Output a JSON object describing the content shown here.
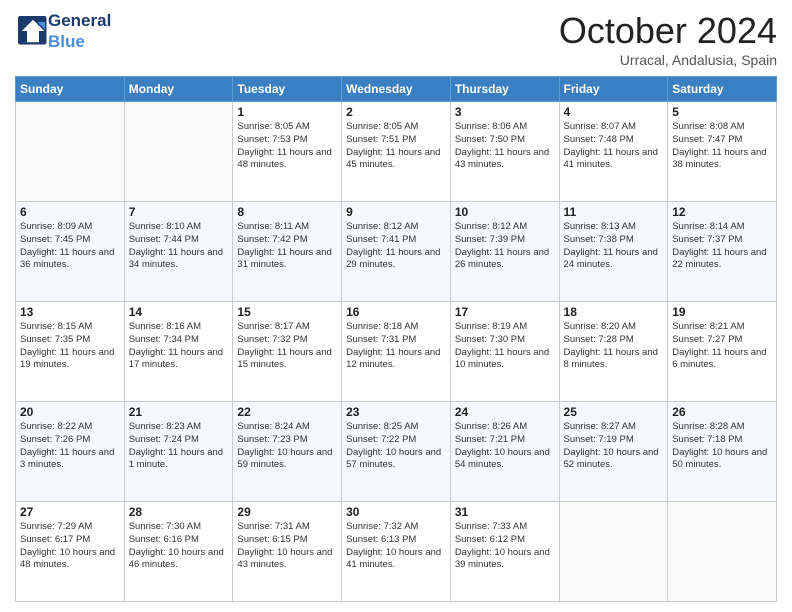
{
  "header": {
    "logo_general": "General",
    "logo_blue": "Blue",
    "month_title": "October 2024",
    "subtitle": "Urracal, Andalusia, Spain"
  },
  "weekdays": [
    "Sunday",
    "Monday",
    "Tuesday",
    "Wednesday",
    "Thursday",
    "Friday",
    "Saturday"
  ],
  "weeks": [
    [
      {
        "day": "",
        "info": ""
      },
      {
        "day": "",
        "info": ""
      },
      {
        "day": "1",
        "info": "Sunrise: 8:05 AM\nSunset: 7:53 PM\nDaylight: 11 hours and 48 minutes."
      },
      {
        "day": "2",
        "info": "Sunrise: 8:05 AM\nSunset: 7:51 PM\nDaylight: 11 hours and 45 minutes."
      },
      {
        "day": "3",
        "info": "Sunrise: 8:06 AM\nSunset: 7:50 PM\nDaylight: 11 hours and 43 minutes."
      },
      {
        "day": "4",
        "info": "Sunrise: 8:07 AM\nSunset: 7:48 PM\nDaylight: 11 hours and 41 minutes."
      },
      {
        "day": "5",
        "info": "Sunrise: 8:08 AM\nSunset: 7:47 PM\nDaylight: 11 hours and 38 minutes."
      }
    ],
    [
      {
        "day": "6",
        "info": "Sunrise: 8:09 AM\nSunset: 7:45 PM\nDaylight: 11 hours and 36 minutes."
      },
      {
        "day": "7",
        "info": "Sunrise: 8:10 AM\nSunset: 7:44 PM\nDaylight: 11 hours and 34 minutes."
      },
      {
        "day": "8",
        "info": "Sunrise: 8:11 AM\nSunset: 7:42 PM\nDaylight: 11 hours and 31 minutes."
      },
      {
        "day": "9",
        "info": "Sunrise: 8:12 AM\nSunset: 7:41 PM\nDaylight: 11 hours and 29 minutes."
      },
      {
        "day": "10",
        "info": "Sunrise: 8:12 AM\nSunset: 7:39 PM\nDaylight: 11 hours and 26 minutes."
      },
      {
        "day": "11",
        "info": "Sunrise: 8:13 AM\nSunset: 7:38 PM\nDaylight: 11 hours and 24 minutes."
      },
      {
        "day": "12",
        "info": "Sunrise: 8:14 AM\nSunset: 7:37 PM\nDaylight: 11 hours and 22 minutes."
      }
    ],
    [
      {
        "day": "13",
        "info": "Sunrise: 8:15 AM\nSunset: 7:35 PM\nDaylight: 11 hours and 19 minutes."
      },
      {
        "day": "14",
        "info": "Sunrise: 8:16 AM\nSunset: 7:34 PM\nDaylight: 11 hours and 17 minutes."
      },
      {
        "day": "15",
        "info": "Sunrise: 8:17 AM\nSunset: 7:32 PM\nDaylight: 11 hours and 15 minutes."
      },
      {
        "day": "16",
        "info": "Sunrise: 8:18 AM\nSunset: 7:31 PM\nDaylight: 11 hours and 12 minutes."
      },
      {
        "day": "17",
        "info": "Sunrise: 8:19 AM\nSunset: 7:30 PM\nDaylight: 11 hours and 10 minutes."
      },
      {
        "day": "18",
        "info": "Sunrise: 8:20 AM\nSunset: 7:28 PM\nDaylight: 11 hours and 8 minutes."
      },
      {
        "day": "19",
        "info": "Sunrise: 8:21 AM\nSunset: 7:27 PM\nDaylight: 11 hours and 6 minutes."
      }
    ],
    [
      {
        "day": "20",
        "info": "Sunrise: 8:22 AM\nSunset: 7:26 PM\nDaylight: 11 hours and 3 minutes."
      },
      {
        "day": "21",
        "info": "Sunrise: 8:23 AM\nSunset: 7:24 PM\nDaylight: 11 hours and 1 minute."
      },
      {
        "day": "22",
        "info": "Sunrise: 8:24 AM\nSunset: 7:23 PM\nDaylight: 10 hours and 59 minutes."
      },
      {
        "day": "23",
        "info": "Sunrise: 8:25 AM\nSunset: 7:22 PM\nDaylight: 10 hours and 57 minutes."
      },
      {
        "day": "24",
        "info": "Sunrise: 8:26 AM\nSunset: 7:21 PM\nDaylight: 10 hours and 54 minutes."
      },
      {
        "day": "25",
        "info": "Sunrise: 8:27 AM\nSunset: 7:19 PM\nDaylight: 10 hours and 52 minutes."
      },
      {
        "day": "26",
        "info": "Sunrise: 8:28 AM\nSunset: 7:18 PM\nDaylight: 10 hours and 50 minutes."
      }
    ],
    [
      {
        "day": "27",
        "info": "Sunrise: 7:29 AM\nSunset: 6:17 PM\nDaylight: 10 hours and 48 minutes."
      },
      {
        "day": "28",
        "info": "Sunrise: 7:30 AM\nSunset: 6:16 PM\nDaylight: 10 hours and 46 minutes."
      },
      {
        "day": "29",
        "info": "Sunrise: 7:31 AM\nSunset: 6:15 PM\nDaylight: 10 hours and 43 minutes."
      },
      {
        "day": "30",
        "info": "Sunrise: 7:32 AM\nSunset: 6:13 PM\nDaylight: 10 hours and 41 minutes."
      },
      {
        "day": "31",
        "info": "Sunrise: 7:33 AM\nSunset: 6:12 PM\nDaylight: 10 hours and 39 minutes."
      },
      {
        "day": "",
        "info": ""
      },
      {
        "day": "",
        "info": ""
      }
    ]
  ]
}
